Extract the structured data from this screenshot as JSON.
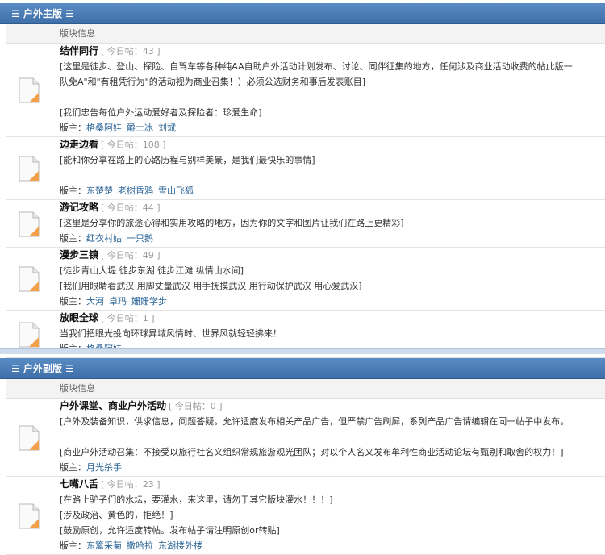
{
  "sections": [
    {
      "title": "户外主版",
      "col_header": "版块信息",
      "forums": [
        {
          "name": "结伴同行",
          "today": "[ 今日帖：43 ]",
          "desc": [
            "[这里是徒步、登山、探险、自驾车等各种纯AA自助户外活动计划发布、讨论、同伴征集的地方，任何涉及商业活动收费的帖此版一",
            "队免A\"和\"有租凭行为\"的活动视为商业召集！）必须公选财务和事后发表账目]",
            "",
            "[我们忠告每位户外运动爱好者及探险者：珍爱生命]"
          ],
          "mods_label": "版主：",
          "mods": [
            "格桑阿娃",
            "爵士冰",
            "刘斌"
          ]
        },
        {
          "name": "边走边看",
          "today": "[ 今日帖：108 ]",
          "desc": [
            "[能和你分享在路上的心路历程与别样美景，是我们最快乐的事情]",
            ""
          ],
          "mods_label": "版主：",
          "mods": [
            "东楚楚",
            "老树昏鸦",
            "雪山飞狐"
          ]
        },
        {
          "name": "游记攻略",
          "today": "[ 今日帖：44 ]",
          "desc": [
            "[这里是分享你的旅途心得和实用攻略的地方，因为你的文字和图片让我们在路上更精彩]"
          ],
          "mods_label": "版主：",
          "mods": [
            "红衣村姑",
            "一只鹅"
          ]
        },
        {
          "name": "漫步三镇",
          "today": "[ 今日帖：49 ]",
          "desc": [
            "[徒步青山大堤 徒步东湖   徒步江滩   纵情山水间]",
            "[我们用眼睛看武汉   用脚丈量武汉   用手抚摸武汉   用行动保护武汉   用心爱武汉]"
          ],
          "mods_label": "版主：",
          "mods": [
            "大河",
            "卓玛",
            "姗姗学步"
          ]
        },
        {
          "name": "放眼全球",
          "today": "[ 今日帖：1 ]",
          "desc": [
            "当我们把眼光投向环球异域风情时、世界风就轻轻拂来！"
          ],
          "mods_label": "版主：",
          "mods": [
            "格桑阿娃"
          ]
        }
      ]
    },
    {
      "title": "户外副版",
      "col_header": "版块信息",
      "forums": [
        {
          "name": "户外课堂、商业户外活动",
          "today": "[ 今日帖：0 ]",
          "desc": [
            "[户外及装备知识，供求信息，问题答疑。允许适度发布相关产品广告，但严禁广告刷屏，系列产品广告请编辑在同一帖子中发布。",
            "",
            "[商业户外活动召集：不接受以旅行社名义组织常规旅游观光团队；对以个人名义发布牟利性商业活动论坛有甄别和取舍的权力！]"
          ],
          "mods_label": "版主：",
          "mods": [
            "月光杀手"
          ]
        },
        {
          "name": "七嘴八舌",
          "today": "[ 今日帖：23 ]",
          "desc": [
            "[在路上驴子们的水坛，要灌水，来这里，请勿于其它版块灌水！！！]",
            "[涉及政治、黄色的，拒绝！]",
            "[鼓励原创，允许适度转帖。发布帖子请注明原创or转贴]"
          ],
          "mods_label": "版主：",
          "mods": [
            "东篱采菊",
            "撒哈拉",
            "东湖楼外楼"
          ]
        }
      ]
    }
  ]
}
